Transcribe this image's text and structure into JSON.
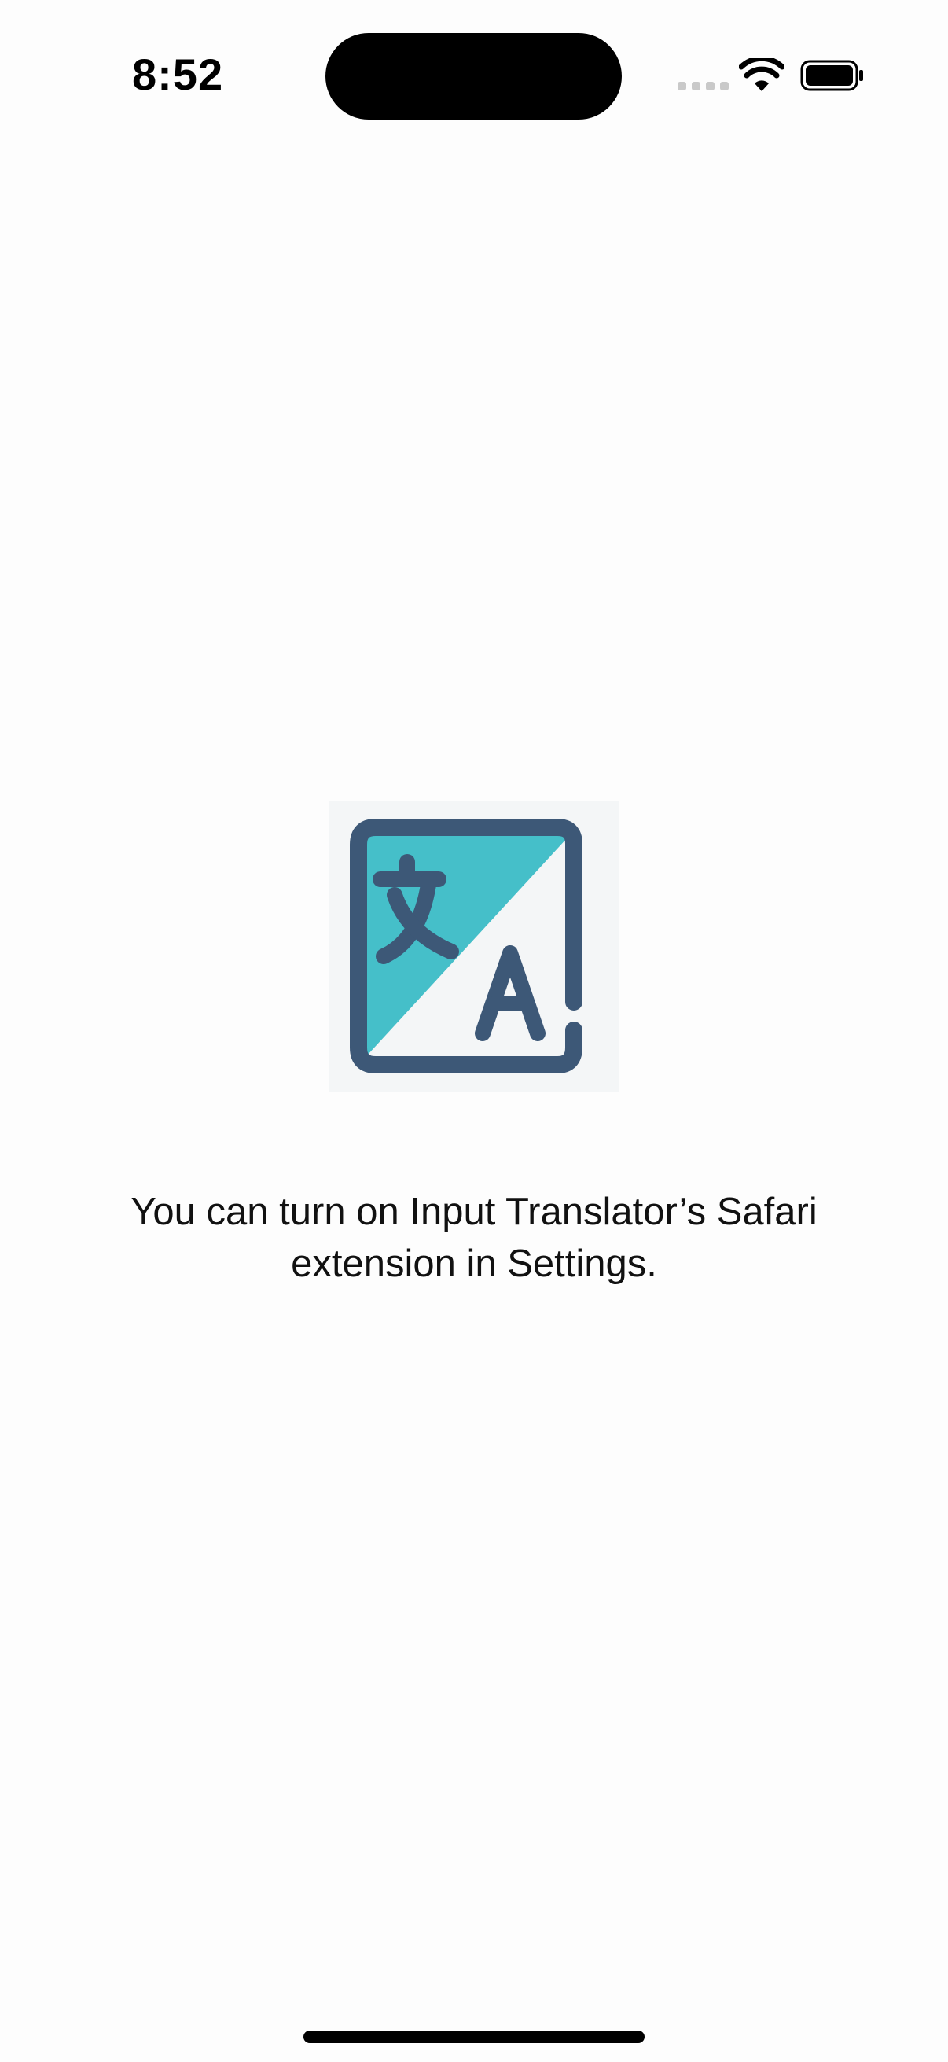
{
  "status_bar": {
    "time": "8:52",
    "icons": [
      "cellular-signal-icon",
      "wifi-icon",
      "battery-icon"
    ]
  },
  "main": {
    "app_icon": "translate-icon",
    "message": "You can turn on Input Translator’s Safari extension in Settings."
  },
  "colors": {
    "icon_teal": "#45bfc9",
    "icon_navy": "#3d5877",
    "background": "#fdfdfd"
  }
}
